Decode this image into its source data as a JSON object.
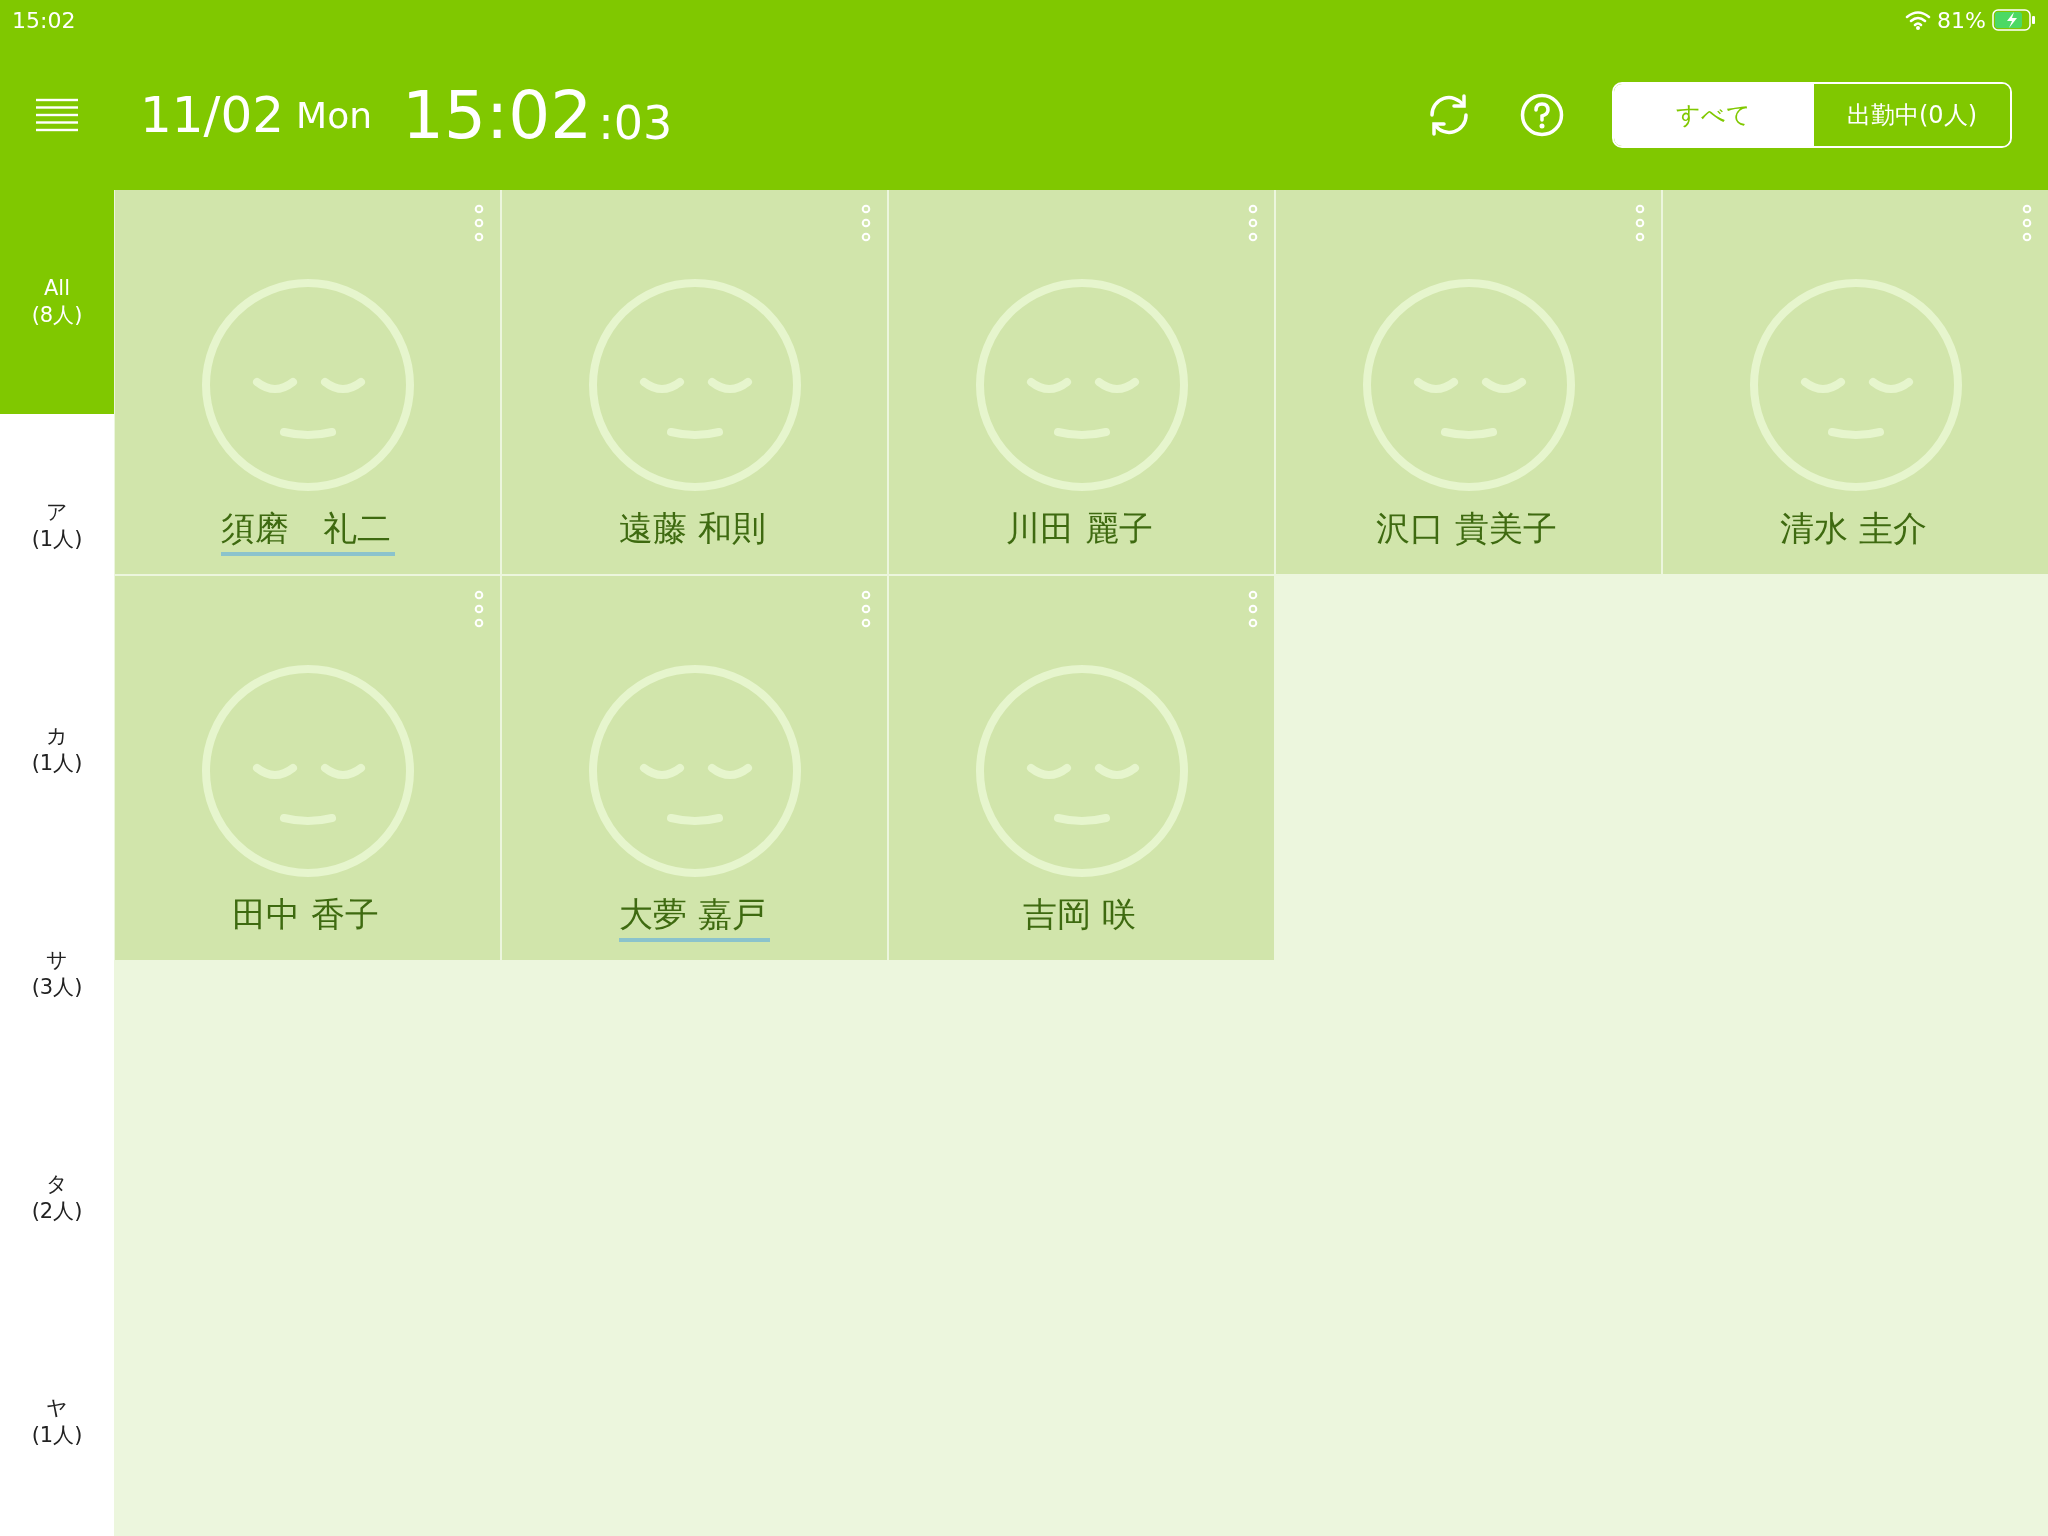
{
  "status_bar": {
    "time": "15:02",
    "battery_text": "81%",
    "charging": true
  },
  "header": {
    "date": "11/02",
    "weekday": "Mon",
    "time_main": "15:02",
    "time_seconds": ":03"
  },
  "filter_tabs": [
    {
      "label": "すべて",
      "selected": true
    },
    {
      "label": "出勤中(0人)",
      "selected": false
    }
  ],
  "sidebar": {
    "items": [
      {
        "label": "All",
        "count": "(8人)",
        "selected": true
      },
      {
        "label": "ア",
        "count": "(1人)",
        "selected": false
      },
      {
        "label": "カ",
        "count": "(1人)",
        "selected": false
      },
      {
        "label": "サ",
        "count": "(3人)",
        "selected": false
      },
      {
        "label": "タ",
        "count": "(2人)",
        "selected": false
      },
      {
        "label": "ヤ",
        "count": "(1人)",
        "selected": false
      }
    ]
  },
  "staff": [
    {
      "name": "須磨　礼二",
      "underlined": true
    },
    {
      "name": "遠藤 和則",
      "underlined": false
    },
    {
      "name": "川田 麗子",
      "underlined": false
    },
    {
      "name": "沢口 貴美子",
      "underlined": false
    },
    {
      "name": "清水 圭介",
      "underlined": false
    },
    {
      "name": "田中 香子",
      "underlined": false
    },
    {
      "name": "大夢 嘉戸",
      "underlined": true
    },
    {
      "name": "吉岡 咲",
      "underlined": false
    }
  ]
}
